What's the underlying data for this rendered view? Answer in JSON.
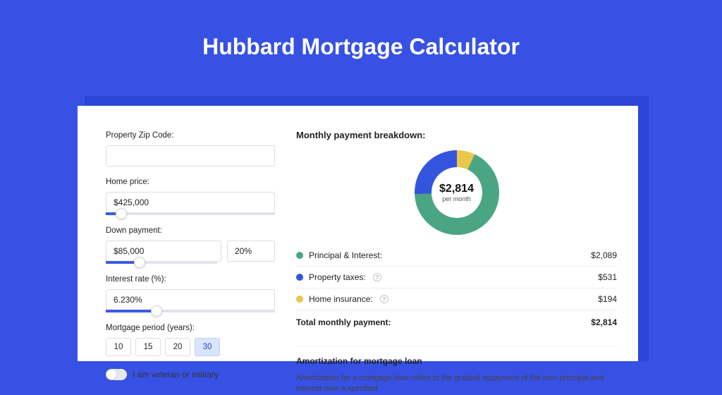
{
  "title": "Hubbard Mortgage Calculator",
  "form": {
    "zip": {
      "label": "Property Zip Code:",
      "value": ""
    },
    "homePrice": {
      "label": "Home price:",
      "value": "$425,000",
      "sliderPct": 9
    },
    "downPayment": {
      "label": "Down payment:",
      "amount": "$85,000",
      "pct": "20%",
      "sliderPct": 20
    },
    "interest": {
      "label": "Interest rate (%):",
      "value": "6.230%",
      "sliderPct": 30
    },
    "period": {
      "label": "Mortgage period (years):",
      "options": [
        "10",
        "15",
        "20",
        "30"
      ],
      "selected": "30"
    },
    "veteran": {
      "label": "I am veteran or military",
      "checked": false
    }
  },
  "breakdown": {
    "title": "Monthly payment breakdown:",
    "donut": {
      "amount": "$2,814",
      "sub": "per month"
    },
    "items": [
      {
        "color": "green",
        "label": "Principal & Interest:",
        "value": "$2,089",
        "info": false
      },
      {
        "color": "blue",
        "label": "Property taxes:",
        "value": "$531",
        "info": true
      },
      {
        "color": "yellow",
        "label": "Home insurance:",
        "value": "$194",
        "info": true
      }
    ],
    "total": {
      "label": "Total monthly payment:",
      "value": "$2,814"
    }
  },
  "amort": {
    "title": "Amortization for mortgage loan",
    "body": "Amortization for a mortgage loan refers to the gradual repayment of the loan principal and interest over a specified"
  },
  "chart_data": {
    "type": "pie",
    "title": "Monthly payment breakdown",
    "series": [
      {
        "name": "Principal & Interest",
        "value": 2089,
        "color": "#4aa585"
      },
      {
        "name": "Property taxes",
        "value": 531,
        "color": "#3355dd"
      },
      {
        "name": "Home insurance",
        "value": 194,
        "color": "#e8c84a"
      }
    ],
    "total": 2814,
    "unit": "$ per month"
  }
}
